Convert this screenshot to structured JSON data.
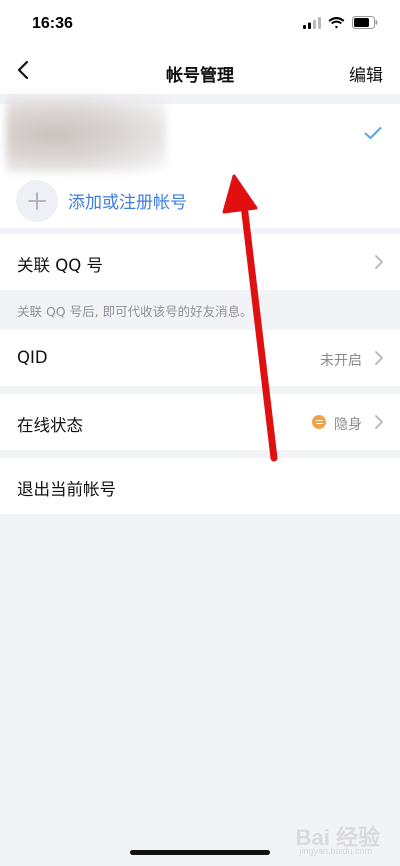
{
  "status_bar": {
    "time": "16:36"
  },
  "nav": {
    "title": "帐号管理",
    "edit_label": "编辑"
  },
  "account": {
    "add_label": "添加或注册帐号"
  },
  "linked_qq": {
    "label": "关联 QQ 号",
    "hint": "关联 QQ 号后, 即可代收该号的好友消息。"
  },
  "qid": {
    "label": "QID",
    "value": "未开启"
  },
  "online_status": {
    "label": "在线状态",
    "value": "隐身",
    "dot_color": "#f0a24a"
  },
  "logout": {
    "label": "退出当前帐号"
  },
  "watermark": {
    "text": "Bai 经验",
    "sub": "jingyan.baidu.com"
  },
  "colors": {
    "accent": "#3d7ee0",
    "check": "#5aa7e8",
    "annotation_arrow": "#e01010"
  }
}
